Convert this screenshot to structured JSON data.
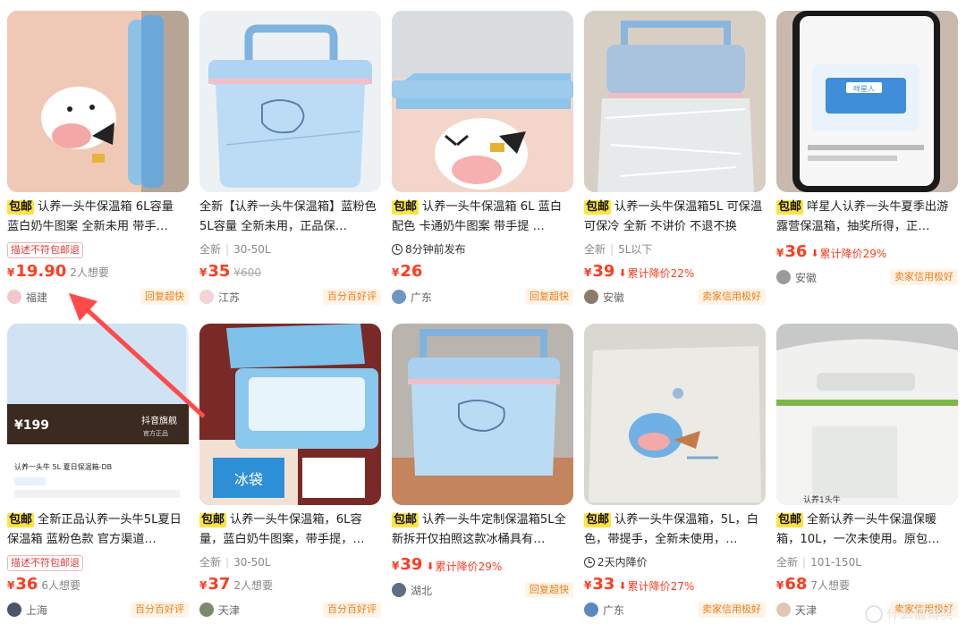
{
  "items": [
    {
      "tag": "包邮",
      "title": "认养一头牛保温箱 6L容量 蓝白奶牛图案 全新未用 带手…",
      "badge": "描述不符包邮退",
      "price_cur": "¥",
      "price": "19.90",
      "want": "2人想要",
      "location": "福建",
      "seller_tag": "回复超快"
    },
    {
      "tag": "",
      "title": "全新【认养一头牛保温箱】蓝粉色 5L容量 全新未用，正品保…",
      "meta1": "全新",
      "meta2": "30-50L",
      "price_cur": "¥",
      "price": "35",
      "orig": "¥600",
      "location": "江苏",
      "seller_tag": "百分百好评"
    },
    {
      "tag": "包邮",
      "title": "认养一头牛保温箱 6L 蓝白配色 卡通奶牛图案 带手提 …",
      "time_badge": "8分钟前发布",
      "price_cur": "¥",
      "price": "26",
      "location": "广东",
      "seller_tag": "回复超快"
    },
    {
      "tag": "包邮",
      "title": "认养一头牛保温箱5L 可保温可保冷 全新 不讲价 不退不换",
      "meta1": "全新",
      "meta2": "5L以下",
      "price_cur": "¥",
      "price": "39",
      "drop": "累计降价22%",
      "location": "安徽",
      "seller_tag": "卖家信用极好"
    },
    {
      "tag": "包邮",
      "title": "咩星人认养一头牛夏季出游露营保温箱，抽奖所得，正…",
      "price_cur": "¥",
      "price": "36",
      "drop": "累计降价29%",
      "location": "安徽",
      "seller_tag": "卖家信用极好"
    },
    {
      "tag": "包邮",
      "title": "全新正品认养一头牛5L夏日保温箱 蓝粉色款 官方渠道…",
      "badge": "描述不符包邮退",
      "price_cur": "¥",
      "price": "36",
      "want": "6人想要",
      "location": "上海",
      "seller_tag": "百分百好评"
    },
    {
      "tag": "包邮",
      "title": "认养一头牛保温箱，6L容量，蓝白奶牛图案，带手提，…",
      "meta1": "全新",
      "meta2": "30-50L",
      "price_cur": "¥",
      "price": "37",
      "want": "2人想要",
      "location": "天津",
      "seller_tag": "百分百好评"
    },
    {
      "tag": "包邮",
      "title": "认养一头牛定制保温箱5L全新拆开仅拍照这款冰桶具有…",
      "price_cur": "¥",
      "price": "39",
      "drop": "累计降价29%",
      "location": "湖北",
      "seller_tag": "回复超快"
    },
    {
      "tag": "包邮",
      "title": "认养一头牛保温箱，5L，白色，带提手，全新未使用，…",
      "time_badge": "2天内降价",
      "price_cur": "¥",
      "price": "33",
      "drop": "累计降价27%",
      "location": "广东",
      "seller_tag": "卖家信用极好"
    },
    {
      "tag": "包邮",
      "title": "全新认养一头牛保温保暖箱，10L，一次未使用。原包…",
      "meta1": "全新",
      "meta2": "101-150L",
      "price_cur": "¥",
      "price": "68",
      "want": "7人想要",
      "location": "天津",
      "seller_tag": "卖家信用极好"
    }
  ],
  "thumb_text": {
    "card6_price": "¥199",
    "card6_store": "抖音旗舰",
    "card6_store_sub": "官方正品",
    "card6_product": "认养一头牛 5L 夏日保温箱-DB",
    "card6_bag": "冰袋",
    "card10_brand": "认养1头牛",
    "card5_screen_title": "咩星人"
  },
  "watermark": "什么值得买",
  "colors": {
    "price": "#ff3b1f",
    "tag_bg": "#ffe33b",
    "arrow": "#ff4a4a"
  }
}
